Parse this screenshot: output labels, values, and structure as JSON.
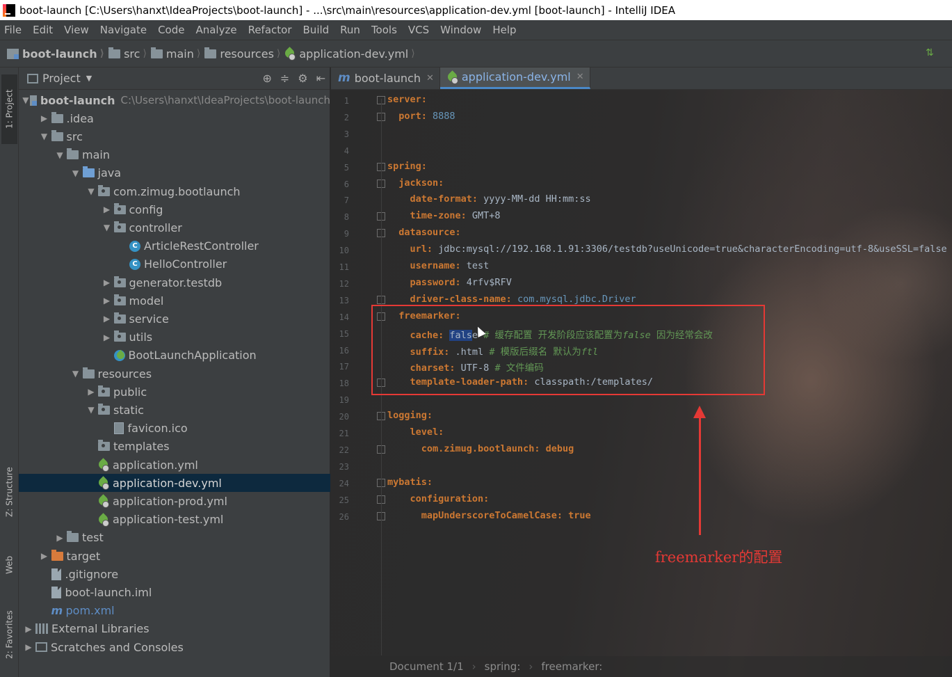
{
  "window": {
    "title": "boot-launch [C:\\Users\\hanxt\\IdeaProjects\\boot-launch] - ...\\src\\main\\resources\\application-dev.yml [boot-launch] - IntelliJ IDEA"
  },
  "menu": [
    "File",
    "Edit",
    "View",
    "Navigate",
    "Code",
    "Analyze",
    "Refactor",
    "Build",
    "Run",
    "Tools",
    "VCS",
    "Window",
    "Help"
  ],
  "breadcrumbs": [
    "boot-launch",
    "src",
    "main",
    "resources",
    "application-dev.yml"
  ],
  "toolwindows": {
    "project": "1: Project",
    "structure": "Z: Structure",
    "web": "Web",
    "favorites": "2: Favorites"
  },
  "project_panel": {
    "title": "Project",
    "root_path": "C:\\Users\\hanxt\\IdeaProjects\\boot-launch",
    "tree": [
      {
        "label": "boot-launch",
        "icon": "module-icon",
        "depth": 0,
        "expanded": true
      },
      {
        "label": ".idea",
        "icon": "folder-icon",
        "depth": 1,
        "expanded": false
      },
      {
        "label": "src",
        "icon": "folder-icon",
        "depth": 1,
        "expanded": true
      },
      {
        "label": "main",
        "icon": "folder-icon",
        "depth": 2,
        "expanded": true
      },
      {
        "label": "java",
        "icon": "source-folder-icon",
        "depth": 3,
        "expanded": true
      },
      {
        "label": "com.zimug.bootlaunch",
        "icon": "package-icon",
        "depth": 4,
        "expanded": true
      },
      {
        "label": "config",
        "icon": "package-icon",
        "depth": 5,
        "expanded": false
      },
      {
        "label": "controller",
        "icon": "package-icon",
        "depth": 5,
        "expanded": true
      },
      {
        "label": "ArticleRestController",
        "icon": "class-icon",
        "depth": 6,
        "expanded": null
      },
      {
        "label": "HelloController",
        "icon": "class-icon",
        "depth": 6,
        "expanded": null
      },
      {
        "label": "generator.testdb",
        "icon": "package-icon",
        "depth": 5,
        "expanded": false
      },
      {
        "label": "model",
        "icon": "package-icon",
        "depth": 5,
        "expanded": false
      },
      {
        "label": "service",
        "icon": "package-icon",
        "depth": 5,
        "expanded": false
      },
      {
        "label": "utils",
        "icon": "package-icon",
        "depth": 5,
        "expanded": false
      },
      {
        "label": "BootLaunchApplication",
        "icon": "spring-boot-class-icon",
        "depth": 5,
        "expanded": null
      },
      {
        "label": "resources",
        "icon": "resources-folder-icon",
        "depth": 3,
        "expanded": true
      },
      {
        "label": "public",
        "icon": "package-icon",
        "depth": 4,
        "expanded": false
      },
      {
        "label": "static",
        "icon": "package-icon",
        "depth": 4,
        "expanded": true
      },
      {
        "label": "favicon.ico",
        "icon": "ico-file-icon",
        "depth": 5,
        "expanded": null
      },
      {
        "label": "templates",
        "icon": "package-icon",
        "depth": 4,
        "expanded": null
      },
      {
        "label": "application.yml",
        "icon": "yml-file-icon",
        "depth": 4,
        "expanded": null
      },
      {
        "label": "application-dev.yml",
        "icon": "yml-file-icon",
        "depth": 4,
        "expanded": null,
        "selected": true
      },
      {
        "label": "application-prod.yml",
        "icon": "yml-file-icon",
        "depth": 4,
        "expanded": null
      },
      {
        "label": "application-test.yml",
        "icon": "yml-file-icon",
        "depth": 4,
        "expanded": null
      },
      {
        "label": "test",
        "icon": "folder-icon",
        "depth": 2,
        "expanded": false
      },
      {
        "label": "target",
        "icon": "excluded-folder-icon",
        "depth": 1,
        "expanded": false
      },
      {
        "label": ".gitignore",
        "icon": "file-icon",
        "depth": 1,
        "expanded": null
      },
      {
        "label": "boot-launch.iml",
        "icon": "file-icon",
        "depth": 1,
        "expanded": null
      },
      {
        "label": "pom.xml",
        "icon": "maven-icon",
        "depth": 1,
        "expanded": null
      },
      {
        "label": "External Libraries",
        "icon": "library-icon",
        "depth": 0,
        "expanded": false
      },
      {
        "label": "Scratches and Consoles",
        "icon": "scratch-icon",
        "depth": 0,
        "expanded": false
      }
    ]
  },
  "editor": {
    "tabs": [
      {
        "label": "boot-launch",
        "icon": "maven-icon",
        "active": false
      },
      {
        "label": "application-dev.yml",
        "icon": "yml-file-icon",
        "active": true
      }
    ],
    "lines": [
      [
        [
          "k",
          "server:"
        ]
      ],
      [
        [
          "k",
          "  port: "
        ],
        [
          "n",
          "8888"
        ]
      ],
      [],
      [],
      [
        [
          "k",
          "spring:"
        ]
      ],
      [
        [
          "k",
          "  jackson:"
        ]
      ],
      [
        [
          "k",
          "    date-format: "
        ],
        [
          "v",
          "yyyy-MM-dd HH:mm:ss"
        ]
      ],
      [
        [
          "k",
          "    time-zone: "
        ],
        [
          "v",
          "GMT+8"
        ]
      ],
      [
        [
          "k",
          "  datasource:"
        ]
      ],
      [
        [
          "k",
          "    url: "
        ],
        [
          "v",
          "jdbc:mysql://192.168.1.91:3306/testdb?useUnicode=true&characterEncoding=utf-8&useSSL=false"
        ]
      ],
      [
        [
          "k",
          "    username: "
        ],
        [
          "v",
          "test"
        ]
      ],
      [
        [
          "k",
          "    password: "
        ],
        [
          "v",
          "4rfv$RFV"
        ]
      ],
      [
        [
          "k",
          "    driver-class-name: "
        ],
        [
          "n",
          "com.mysql.jdbc.Driver"
        ]
      ],
      [
        [
          "k",
          "  freemarker:"
        ]
      ],
      [
        [
          "k",
          "    cache: "
        ],
        [
          "sel",
          "fals"
        ],
        [
          "v",
          "e "
        ],
        [
          "c",
          "# 缓存配置 开发阶段应该配置为"
        ],
        [
          "ci",
          "false"
        ],
        [
          "c",
          " 因为经常会改"
        ]
      ],
      [
        [
          "k",
          "    suffix: "
        ],
        [
          "v",
          ".html "
        ],
        [
          "c",
          "# 模版后缀名 默认为"
        ],
        [
          "ci",
          "ftl"
        ]
      ],
      [
        [
          "k",
          "    charset: "
        ],
        [
          "v",
          "UTF-8 "
        ],
        [
          "c",
          "# 文件编码"
        ]
      ],
      [
        [
          "k",
          "    template-loader-path: "
        ],
        [
          "v",
          "classpath:/templates/"
        ]
      ],
      [],
      [
        [
          "k",
          "logging:"
        ]
      ],
      [
        [
          "k",
          "    level:"
        ]
      ],
      [
        [
          "k",
          "      com.zimug.bootlaunch: "
        ],
        [
          "k",
          "debug"
        ]
      ],
      [],
      [
        [
          "k",
          "mybatis:"
        ]
      ],
      [
        [
          "k",
          "    configuration:"
        ]
      ],
      [
        [
          "k",
          "      mapUnderscoreToCamelCase: "
        ],
        [
          "k",
          "true"
        ]
      ]
    ],
    "annotation": "freemarker的配置"
  },
  "statusbar": {
    "document": "Document 1/1",
    "path": [
      "spring:",
      "freemarker:"
    ]
  }
}
